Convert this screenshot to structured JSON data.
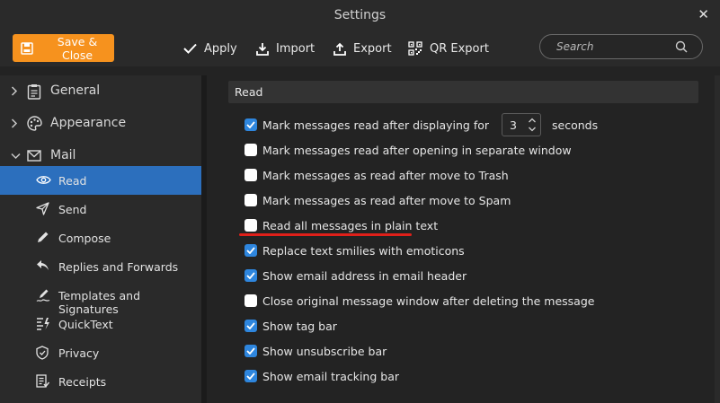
{
  "window": {
    "title": "Settings"
  },
  "toolbar": {
    "save_close": "Save & Close",
    "apply": "Apply",
    "import": "Import",
    "export": "Export",
    "qr_export": "QR Export",
    "search_placeholder": "Search",
    "accent_color": "#f6921e"
  },
  "sidebar": {
    "categories": [
      {
        "label": "General",
        "icon": "clipboard-icon"
      },
      {
        "label": "Appearance",
        "icon": "palette-icon"
      },
      {
        "label": "Mail",
        "icon": "envelope-icon"
      }
    ],
    "mail_items": [
      {
        "label": "Read",
        "icon": "eye-icon",
        "active": true
      },
      {
        "label": "Send",
        "icon": "paper-plane-icon"
      },
      {
        "label": "Compose",
        "icon": "pencil-icon"
      },
      {
        "label": "Replies and Forwards",
        "icon": "reply-icon"
      },
      {
        "label": "Templates and Signatures",
        "icon": "signature-icon"
      },
      {
        "label": "QuickText",
        "icon": "quicktext-icon"
      },
      {
        "label": "Privacy",
        "icon": "shield-icon"
      },
      {
        "label": "Receipts",
        "icon": "receipt-icon"
      }
    ],
    "active_color": "#2c6fbd"
  },
  "main": {
    "section_title": "Read",
    "options": [
      {
        "label": "Mark messages read after displaying for",
        "checked": true,
        "spinner_value": "3",
        "suffix": "seconds"
      },
      {
        "label": "Mark messages read after opening in separate window",
        "checked": false
      },
      {
        "label": "Mark messages as read after move to Trash",
        "checked": false
      },
      {
        "label": "Mark messages as read after move to Spam",
        "checked": false
      },
      {
        "label": "Read all messages in plain text",
        "checked": false
      },
      {
        "label": "Replace text smilies with emoticons",
        "checked": true
      },
      {
        "label": "Show email address in email header",
        "checked": true
      },
      {
        "label": "Close original message window after deleting the message",
        "checked": false
      },
      {
        "label": "Show tag bar",
        "checked": true
      },
      {
        "label": "Show unsubscribe bar",
        "checked": true
      },
      {
        "label": "Show email tracking bar",
        "checked": true
      }
    ],
    "checkbox_color": "#2e86de",
    "highlight_color": "#e0201a"
  }
}
